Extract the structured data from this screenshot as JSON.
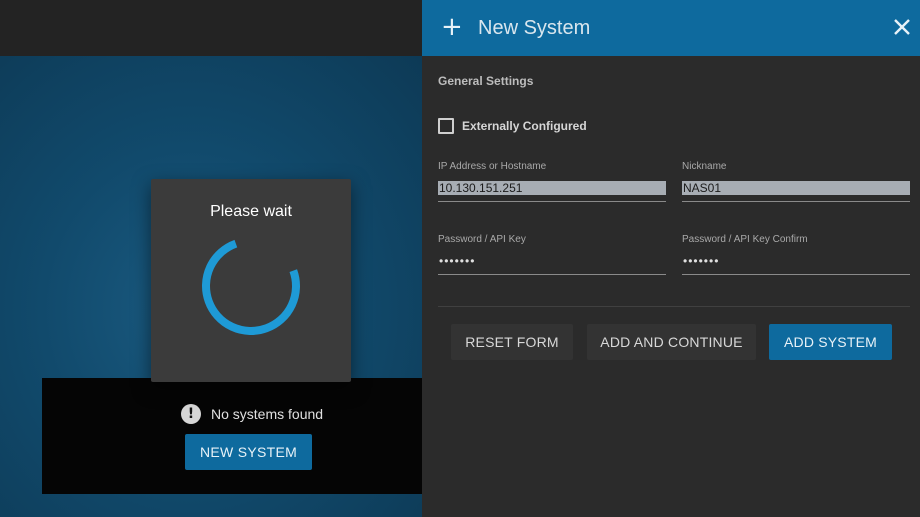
{
  "background": {
    "empty_message": "No systems found",
    "new_system_label": "NEW SYSTEM"
  },
  "wait_dialog": {
    "title": "Please wait"
  },
  "panel": {
    "title": "New System",
    "section_title": "General Settings",
    "externally_configured_label": "Externally Configured",
    "externally_configured_checked": false,
    "fields": {
      "host": {
        "label": "IP Address or Hostname",
        "value": "10.130.151.251"
      },
      "nickname": {
        "label": "Nickname",
        "value": "NAS01"
      },
      "password": {
        "label": "Password / API Key",
        "value": "•••••••"
      },
      "password_confirm": {
        "label": "Password / API Key Confirm",
        "value": "•••••••"
      }
    },
    "buttons": {
      "reset": "RESET FORM",
      "add_continue": "ADD AND CONTINUE",
      "add_system": "ADD SYSTEM"
    }
  },
  "colors": {
    "accent": "#0e6a9e",
    "spinner": "#1e9ad6",
    "panel_bg": "#2b2b2b"
  },
  "icons": {
    "plus": "plus-icon",
    "close": "close-icon",
    "alert": "alert-circle-icon"
  }
}
